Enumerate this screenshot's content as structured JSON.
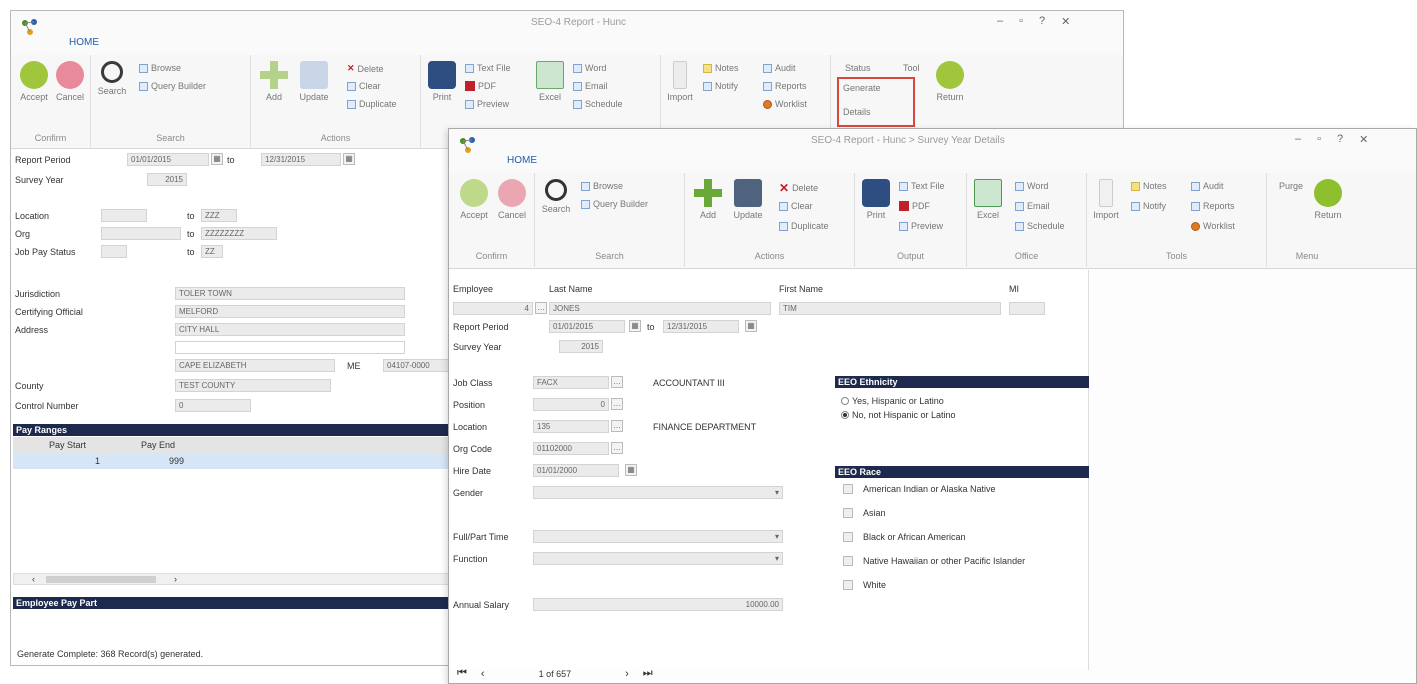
{
  "back_window": {
    "title": "SEO-4 Report - Hunc",
    "home_tab": "HOME",
    "ribbon": {
      "confirm": {
        "label": "Confirm",
        "accept": "Accept",
        "cancel": "Cancel"
      },
      "search": {
        "label": "Search",
        "search": "Search",
        "browse": "Browse",
        "query_builder": "Query Builder"
      },
      "actions": {
        "label": "Actions",
        "add": "Add",
        "update": "Update",
        "delete": "Delete",
        "clear": "Clear",
        "duplicate": "Duplicate"
      },
      "output": {
        "print": "Print",
        "text_file": "Text File",
        "pdf": "PDF",
        "preview": "Preview",
        "excel": "Excel",
        "word": "Word",
        "email": "Email",
        "schedule": "Schedule"
      },
      "tools": {
        "import": "Import",
        "notes": "Notes",
        "audit": "Audit",
        "notify": "Notify",
        "reports": "Reports",
        "worklist": "Worklist"
      },
      "extra": {
        "status": "Status",
        "tool": "Tool",
        "generate": "Generate",
        "details": "Details",
        "return": "Return"
      }
    },
    "form": {
      "report_period_label": "Report Period",
      "report_period_from": "01/01/2015",
      "to_label": "to",
      "report_period_to": "12/31/2015",
      "survey_year_label": "Survey Year",
      "survey_year": "2015",
      "location_label": "Location",
      "location_to": "ZZZ",
      "org_label": "Org",
      "org_to": "ZZZZZZZZ",
      "job_pay_status_label": "Job Pay Status",
      "job_pay_status_to": "ZZ",
      "jurisdiction_label": "Jurisdiction",
      "jurisdiction": "TOLER TOWN",
      "certifying_official_label": "Certifying Official",
      "certifying_official": "MELFORD",
      "address_label": "Address",
      "address1": "CITY HALL",
      "city": "CAPE ELIZABETH",
      "state": "ME",
      "zip": "04107-0000",
      "county_label": "County",
      "county": "TEST COUNTY",
      "control_number_label": "Control Number",
      "control_number": "0"
    },
    "pay_ranges": {
      "section": "Pay Ranges",
      "col_start": "Pay Start",
      "col_end": "Pay End",
      "row_start": "1",
      "row_end": "999"
    },
    "employee_pay_part_section": "Employee Pay Part",
    "status": "Generate Complete: 368 Record(s) generated."
  },
  "front_window": {
    "title": "SEO-4 Report - Hunc > Survey Year Details",
    "home_tab": "HOME",
    "ribbon": {
      "confirm": {
        "label": "Confirm",
        "accept": "Accept",
        "cancel": "Cancel"
      },
      "search": {
        "label": "Search",
        "search": "Search",
        "browse": "Browse",
        "query_builder": "Query Builder"
      },
      "actions": {
        "label": "Actions",
        "add": "Add",
        "update": "Update",
        "delete": "Delete",
        "clear": "Clear",
        "duplicate": "Duplicate"
      },
      "output": {
        "label": "Output",
        "print": "Print",
        "text_file": "Text File",
        "pdf": "PDF",
        "preview": "Preview",
        "excel": "Excel",
        "word": "Word",
        "email": "Email",
        "schedule": "Schedule"
      },
      "office": {
        "label": "Office"
      },
      "tools": {
        "label": "Tools",
        "import": "Import",
        "notes": "Notes",
        "audit": "Audit",
        "notify": "Notify",
        "reports": "Reports",
        "worklist": "Worklist"
      },
      "menu": {
        "label": "Menu",
        "purge": "Purge",
        "return": "Return"
      }
    },
    "form": {
      "employee_label": "Employee",
      "employee": "4",
      "last_name_label": "Last Name",
      "last_name": "JONES",
      "first_name_label": "First Name",
      "first_name": "TIM",
      "mi_label": "MI",
      "report_period_label": "Report Period",
      "report_period_from": "01/01/2015",
      "to_label": "to",
      "report_period_to": "12/31/2015",
      "survey_year_label": "Survey Year",
      "survey_year": "2015",
      "job_class_label": "Job Class",
      "job_class": "FACX",
      "job_class_desc": "ACCOUNTANT III",
      "position_label": "Position",
      "position": "0",
      "location_label": "Location",
      "location": "135",
      "location_desc": "FINANCE DEPARTMENT",
      "org_code_label": "Org Code",
      "org_code": "01102000",
      "hire_date_label": "Hire Date",
      "hire_date": "01/01/2000",
      "gender_label": "Gender",
      "full_part_time_label": "Full/Part Time",
      "function_label": "Function",
      "annual_salary_label": "Annual Salary",
      "annual_salary": "10000.00"
    },
    "eeo_ethnicity": {
      "section": "EEO Ethnicity",
      "opt1": "Yes, Hispanic or Latino",
      "opt2": "No, not Hispanic or Latino"
    },
    "eeo_race": {
      "section": "EEO Race",
      "opt1": "American Indian or Alaska Native",
      "opt2": "Asian",
      "opt3": "Black or African American",
      "opt4": "Native Hawaiian or other Pacific Islander",
      "opt5": "White"
    },
    "pager": {
      "text": "1 of 657"
    }
  }
}
